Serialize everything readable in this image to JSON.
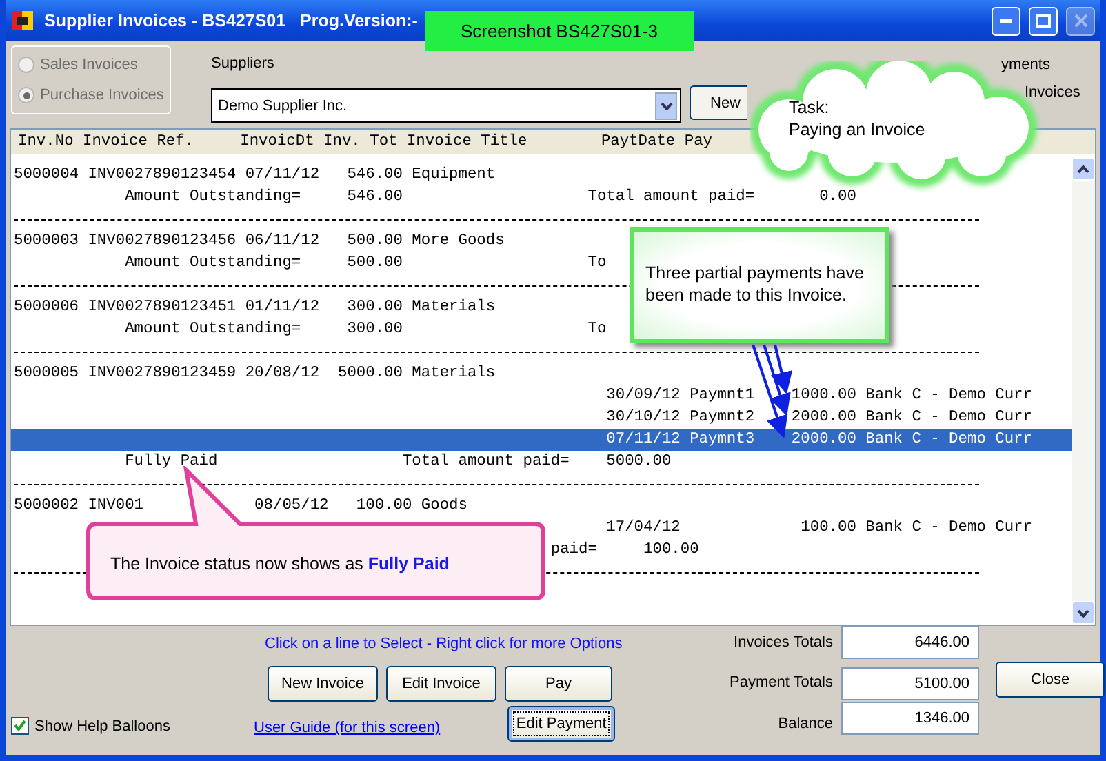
{
  "window": {
    "title": "Supplier Invoices - BS427S01   Prog.Version:-",
    "close_disabled": true
  },
  "screenshot_label": "Screenshot BS427S01-3",
  "invoice_type": [
    {
      "label": "Sales Invoices",
      "selected": false,
      "disabled": true
    },
    {
      "label": "Purchase Invoices",
      "selected": true,
      "disabled": true
    }
  ],
  "suppliers": {
    "label": "Suppliers",
    "value": "Demo Supplier Inc."
  },
  "new_button": "New",
  "right_options": [
    "yments",
    "Invoices"
  ],
  "list": {
    "columns": [
      "Inv.No",
      "Invoice Ref.",
      "InvoicDt",
      "Inv. Tot",
      "Invoice Title",
      "PaytDate",
      "Pay"
    ],
    "lines": [
      {
        "kind": "invoice",
        "text": "5000004 INV0027890123454 07/11/12   546.00 Equipment",
        "selected": false
      },
      {
        "kind": "summary",
        "text": "Amount Outstanding=     546.00                    Total amount paid=       0.00",
        "selected": false
      },
      {
        "kind": "divider",
        "selected": false
      },
      {
        "kind": "invoice",
        "text": "5000003 INV0027890123456 06/11/12   500.00 More Goods",
        "selected": false
      },
      {
        "kind": "summary",
        "text": "Amount Outstanding=     500.00                    To",
        "selected": false
      },
      {
        "kind": "divider",
        "selected": false
      },
      {
        "kind": "invoice",
        "text": "5000006 INV0027890123451 01/11/12   300.00 Materials",
        "selected": false
      },
      {
        "kind": "summary",
        "text": "Amount Outstanding=     300.00                    To",
        "selected": false
      },
      {
        "kind": "divider",
        "selected": false
      },
      {
        "kind": "invoice",
        "text": "5000005 INV0027890123459 20/08/12  5000.00 Materials",
        "selected": false
      },
      {
        "kind": "payment",
        "text": "30/09/12 Paymnt1    1000.00 Bank C - Demo Curr",
        "selected": false
      },
      {
        "kind": "payment",
        "text": "30/10/12 Paymnt2    2000.00 Bank C - Demo Curr",
        "selected": false
      },
      {
        "kind": "payment",
        "text": "07/11/12 Paymnt3    2000.00 Bank C - Demo Curr",
        "selected": true
      },
      {
        "kind": "summary",
        "text": "Fully Paid                    Total amount paid=    5000.00",
        "selected": false
      },
      {
        "kind": "divider",
        "selected": false
      },
      {
        "kind": "invoice",
        "text": "5000002 INV001            08/05/12   100.00 Goods",
        "selected": false
      },
      {
        "kind": "payment",
        "text": "17/04/12             100.00 Bank C - Demo Curr",
        "selected": false
      },
      {
        "kind": "fragment",
        "text": "paid=     100.00",
        "selected": false
      },
      {
        "kind": "divider",
        "selected": false
      }
    ]
  },
  "hint": "Click on a line to Select - Right click for more Options",
  "buttons": [
    "New Invoice",
    "Edit Invoice",
    "Pay"
  ],
  "edit_payment": "Edit Payment",
  "show_help": {
    "label": "Show Help Balloons",
    "checked": true
  },
  "user_guide": "User Guide (for this screen)",
  "totals": [
    {
      "label": "Invoices Totals",
      "value": "6446.00"
    },
    {
      "label": "Payment Totals",
      "value": "5100.00"
    },
    {
      "label": "Balance",
      "value": "1346.00"
    }
  ],
  "close": "Close",
  "balloons": [
    {
      "kind": "cloud",
      "lines": [
        "Task:",
        "Paying an Invoice"
      ]
    },
    {
      "kind": "note",
      "lines": [
        "Three partial payments have been made to this Invoice."
      ]
    },
    {
      "kind": "pointer",
      "lines": [
        "The Invoice status now shows as **Fully Paid**"
      ]
    }
  ]
}
